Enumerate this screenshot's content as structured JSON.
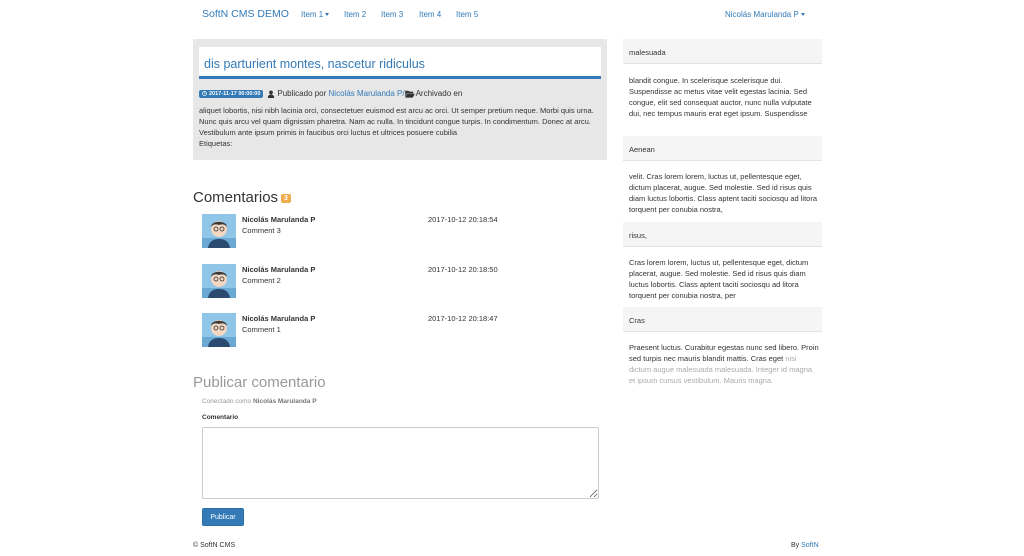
{
  "navbar": {
    "brand": "SoftN CMS DEMO",
    "items": [
      "Item 1",
      "Item 2",
      "Item 3",
      "Item 4",
      "Item 5"
    ],
    "user": "Nicolás Marulanda P"
  },
  "post": {
    "title": "dis parturient montes, nascetur ridiculus",
    "date": "2017-11-17 00:00:00",
    "published_by_label": "Publicado por",
    "author": "Nicolás Marulanda P",
    "author_suffix": "/",
    "archived_label": "Archivado en",
    "body": "aliquet lobortis, nisi nibh lacinia orci, consectetuer euismod est arcu ac orci. Ut semper pretium neque. Morbi quis urna. Nunc quis arcu vel quam dignissim pharetra. Nam ac nulla. In tincidunt congue turpis. In condimentum. Donec at arcu. Vestibulum ante ipsum primis in faucibus orci luctus et ultrices posuere cubilia",
    "tags_label": "Etiquetas:"
  },
  "comments": {
    "heading": "Comentarios",
    "count": "3",
    "items": [
      {
        "author": "Nicolás Marulanda P",
        "text": "Comment 3",
        "date": "2017-10-12 20:18:54"
      },
      {
        "author": "Nicolás Marulanda P",
        "text": "Comment 2",
        "date": "2017-10-12 20:18:50"
      },
      {
        "author": "Nicolás Marulanda P",
        "text": "Comment 1",
        "date": "2017-10-12 20:18:47"
      }
    ]
  },
  "publish": {
    "heading": "Publicar comentario",
    "logged_prefix": "Conectado como",
    "logged_user": "Nicolás Marulanda P",
    "label": "Comentario",
    "button": "Publicar"
  },
  "footer": {
    "left": "© SoftN CMS",
    "right_prefix": "By",
    "right_link": "SoftN"
  },
  "sidebar": [
    {
      "title": "malesuada",
      "body": "blandit congue. In scelerisque scelerisque dui. Suspendisse ac metus vitae velit egestas lacinia. Sed congue, elit sed consequat auctor, nunc nulla vulputate dui, nec tempus mauris erat eget ipsum. Suspendisse"
    },
    {
      "title": "Aenean",
      "body": "velit. Cras lorem lorem, luctus ut, pellentesque eget, dictum placerat, augue. Sed molestie. Sed id risus quis diam luctus lobortis. Class aptent taciti sociosqu ad litora torquent per conubia nostra,"
    },
    {
      "title": "risus,",
      "body": "Cras lorem lorem, luctus ut, pellentesque eget, dictum placerat, augue. Sed molestie. Sed id risus quis diam luctus lobortis. Class aptent taciti sociosqu ad litora torquent per conubia nostra, per"
    },
    {
      "title": "Cras",
      "body": "Praesent luctus. Curabitur egestas nunc sed libero. Proin sed turpis nec mauris blandit mattis. Cras eget",
      "body_faded": "nisi dictum augue malesuada malesuada. Integer id magna et ipsum cursus vestibulum. Mauris magna."
    }
  ],
  "colors": {
    "link": "#337ab7",
    "badge": "#f0ad4e",
    "panel": "#e7e7e7"
  }
}
